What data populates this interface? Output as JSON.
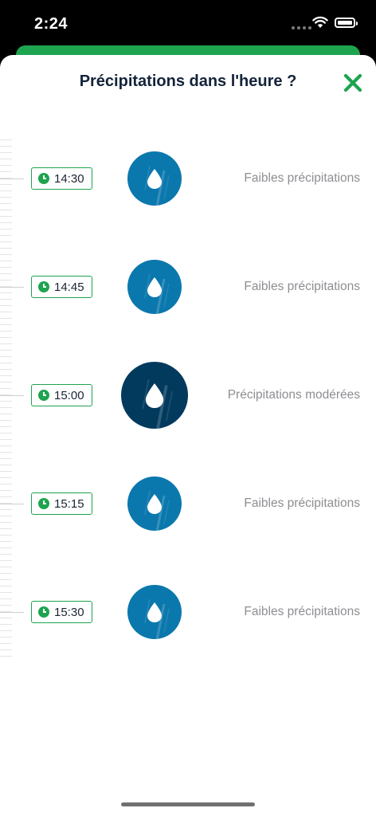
{
  "status_bar": {
    "time": "2:24"
  },
  "modal": {
    "title": "Précipitations dans l'heure ?",
    "close_icon": "close-x-icon"
  },
  "colors": {
    "accent": "#1ea44f",
    "light_rain": "#0b78ad",
    "moderate_rain": "#023a5e",
    "label": "#8e8e93"
  },
  "rows": [
    {
      "time": "14:30",
      "label": "Faibles précipitations",
      "intensity": "light"
    },
    {
      "time": "14:45",
      "label": "Faibles précipitations",
      "intensity": "light"
    },
    {
      "time": "15:00",
      "label": "Précipitations modérées",
      "intensity": "moderate"
    },
    {
      "time": "15:15",
      "label": "Faibles précipitations",
      "intensity": "light"
    },
    {
      "time": "15:30",
      "label": "Faibles précipitations",
      "intensity": "light"
    }
  ]
}
